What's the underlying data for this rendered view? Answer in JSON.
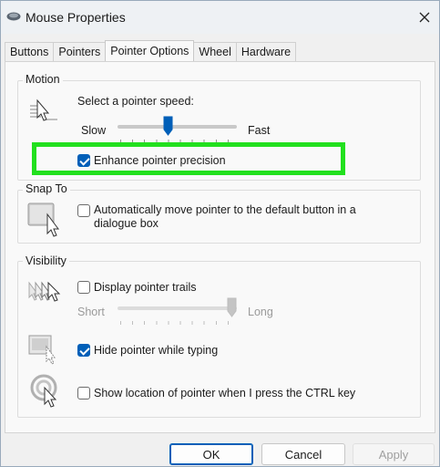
{
  "window": {
    "title": "Mouse Properties",
    "tabs": [
      "Buttons",
      "Pointers",
      "Pointer Options",
      "Wheel",
      "Hardware"
    ],
    "active_tab": "Pointer Options"
  },
  "motion": {
    "group_label": "Motion",
    "speed_label": "Select a pointer speed:",
    "slow_label": "Slow",
    "fast_label": "Fast",
    "speed_value": 0.42,
    "enhance_label": "Enhance pointer precision",
    "enhance_checked": true,
    "highlight_color": "#22e01e"
  },
  "snap_to": {
    "group_label": "Snap To",
    "auto_move_label_line1": "Automatically move pointer to the default button in a",
    "auto_move_label_line2": "dialogue box",
    "auto_move_checked": false
  },
  "visibility": {
    "group_label": "Visibility",
    "trails_label": "Display pointer trails",
    "trails_checked": false,
    "short_label": "Short",
    "long_label": "Long",
    "trail_length_value": 1.0,
    "hide_typing_label": "Hide pointer while typing",
    "hide_typing_checked": true,
    "show_location_label": "Show location of pointer when I press the CTRL key",
    "show_location_checked": false
  },
  "buttons": {
    "ok": "OK",
    "cancel": "Cancel",
    "apply": "Apply"
  },
  "colors": {
    "accent": "#005fb8",
    "highlight": "#22e01e"
  }
}
